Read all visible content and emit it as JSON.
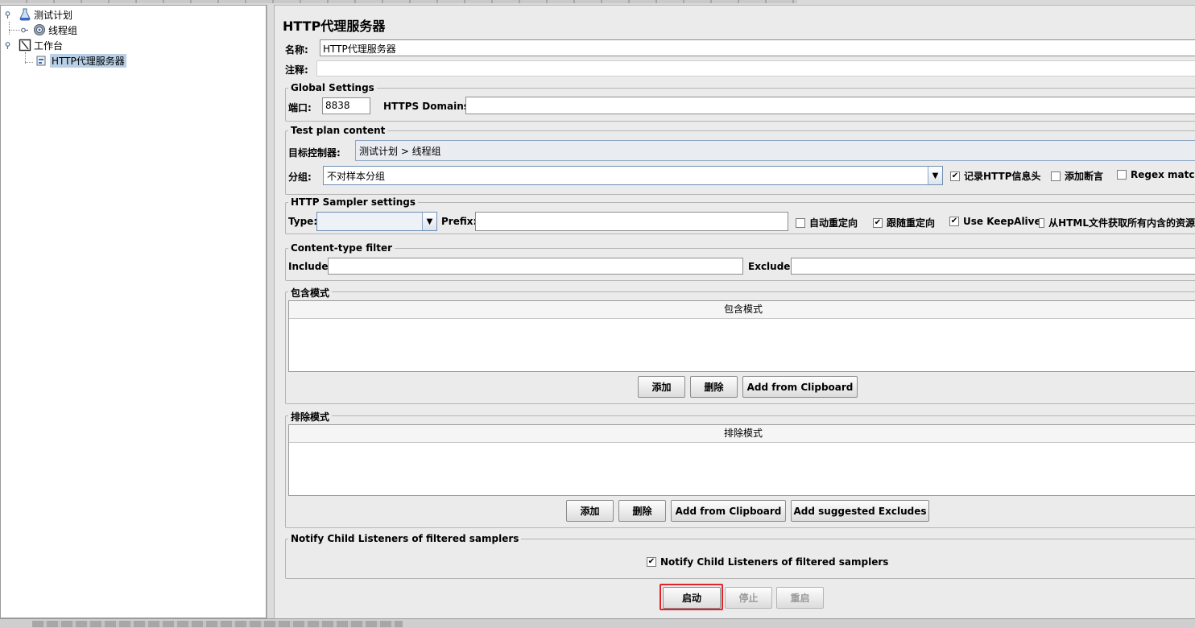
{
  "tree": {
    "test_plan": "测试计划",
    "thread_group": "线程组",
    "workbench": "工作台",
    "proxy_server": "HTTP代理服务器"
  },
  "page": {
    "title": "HTTP代理服务器"
  },
  "name_row": {
    "label": "名称:",
    "value": "HTTP代理服务器"
  },
  "comment_row": {
    "label": "注释:",
    "value": ""
  },
  "global_settings": {
    "title": "Global Settings",
    "port_label": "端口:",
    "port_value": "8838",
    "https_label": "HTTPS Domains :",
    "https_value": ""
  },
  "test_plan_content": {
    "title": "Test plan content",
    "target_label": "目标控制器:",
    "target_value": "测试计划 > 线程组",
    "grouping_label": "分组:",
    "grouping_value": "不对样本分组",
    "cb_record_headers": "记录HTTP信息头",
    "cb_record_headers_checked": true,
    "cb_add_assertions": "添加断言",
    "cb_add_assertions_checked": false,
    "cb_regex": "Regex matchi",
    "cb_regex_checked": false
  },
  "sampler_settings": {
    "title": "HTTP Sampler settings",
    "type_label": "Type:",
    "type_value": "",
    "prefix_label": "Prefix:",
    "prefix_value": "",
    "cb_auto_redirect": "自动重定向",
    "cb_auto_redirect_checked": false,
    "cb_follow_redirect": "跟随重定向",
    "cb_follow_redirect_checked": true,
    "cb_keepalive": "Use KeepAlive",
    "cb_keepalive_checked": true,
    "cb_embedded": "从HTML文件获取所有内含的资源"
  },
  "content_filter": {
    "title": "Content-type filter",
    "include_label": "Include:",
    "include_value": "",
    "exclude_label": "Exclude:",
    "exclude_value": ""
  },
  "include_patterns": {
    "title": "包含模式",
    "column": "包含模式",
    "add": "添加",
    "delete": "删除",
    "clipboard": "Add from Clipboard"
  },
  "exclude_patterns": {
    "title": "排除模式",
    "column": "排除模式",
    "add": "添加",
    "delete": "删除",
    "clipboard": "Add from Clipboard",
    "suggested": "Add suggested Excludes"
  },
  "notify": {
    "title": "Notify Child Listeners of filtered samplers",
    "checkbox": "Notify Child Listeners of filtered samplers",
    "checked": true
  },
  "controls": {
    "start": "启动",
    "stop": "停止",
    "restart": "重启"
  },
  "colors": {
    "highlight": "#e0242a",
    "selection": "#b8cfe5"
  }
}
